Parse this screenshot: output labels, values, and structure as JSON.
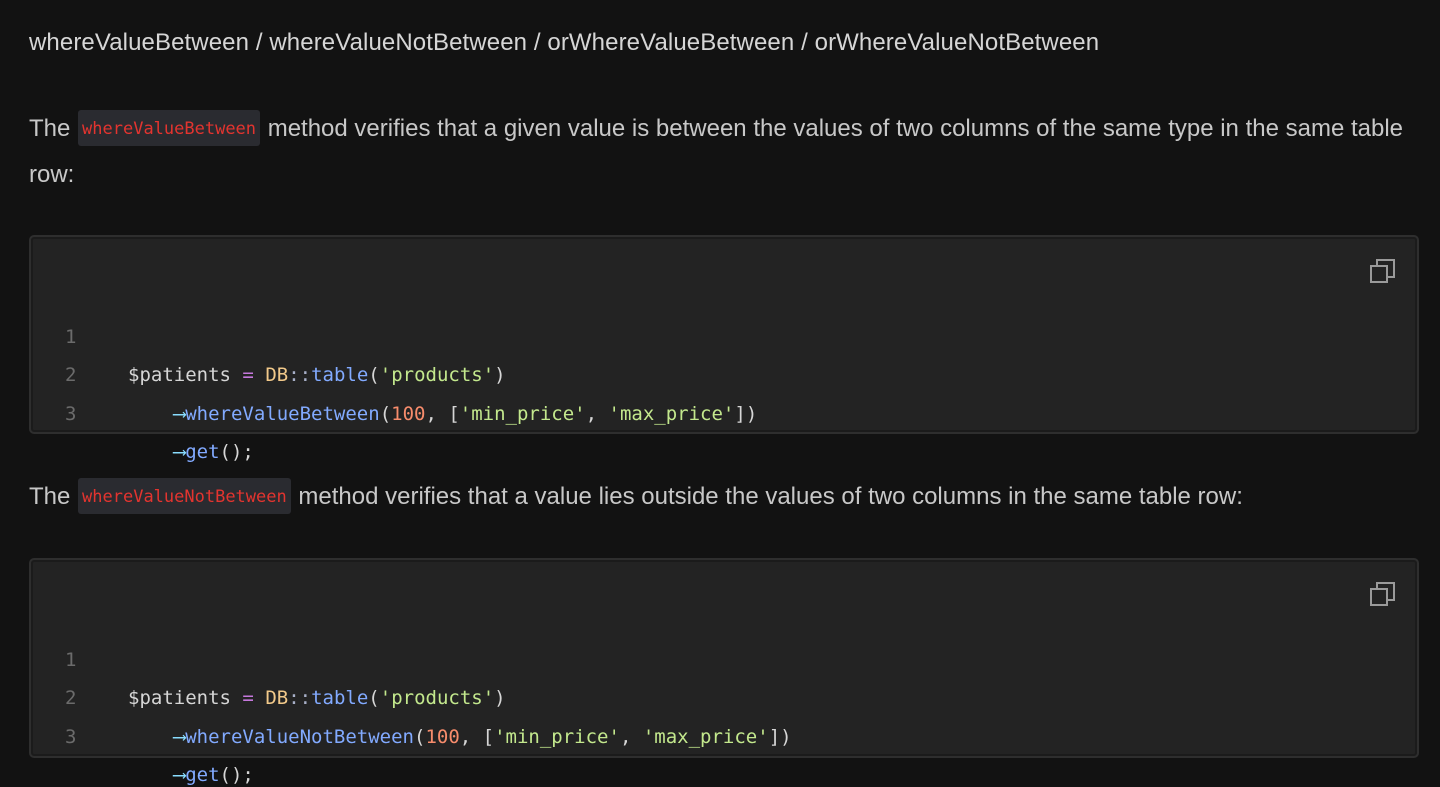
{
  "heading": "whereValueBetween / whereValueNotBetween / orWhereValueBetween / orWhereValueNotBetween",
  "para1": {
    "before": "The ",
    "code": "whereValueBetween",
    "after": " method verifies that a given value is between the values of two columns of the same type in the same table row:"
  },
  "para2": {
    "before": "The ",
    "code": "whereValueNotBetween",
    "after": " method verifies that a value lies outside the values of two columns in the same table row:"
  },
  "code1": {
    "copy_icon": "copy-icon",
    "lines": [
      {
        "num": "1",
        "indent": "",
        "t1": "$patients",
        "t2": " ",
        "t3": "=",
        "t4": " ",
        "t5": "DB",
        "t6": "::",
        "t7": "table",
        "t8": "(",
        "t9": "'products'",
        "t10": ")"
      },
      {
        "num": "2",
        "indent": "    ",
        "arrow": "⟶",
        "fn": "whereValueBetween",
        "open": "(",
        "num_arg": "100",
        "comma1": ", [",
        "s1": "'min_price'",
        "comma2": ", ",
        "s2": "'max_price'",
        "close": "])"
      },
      {
        "num": "3",
        "indent": "    ",
        "arrow": "⟶",
        "fn": "get",
        "rest": "();"
      }
    ]
  },
  "code2": {
    "copy_icon": "copy-icon",
    "lines": [
      {
        "num": "1",
        "indent": "",
        "t1": "$patients",
        "t2": " ",
        "t3": "=",
        "t4": " ",
        "t5": "DB",
        "t6": "::",
        "t7": "table",
        "t8": "(",
        "t9": "'products'",
        "t10": ")"
      },
      {
        "num": "2",
        "indent": "    ",
        "arrow": "⟶",
        "fn": "whereValueNotBetween",
        "open": "(",
        "num_arg": "100",
        "comma1": ", [",
        "s1": "'min_price'",
        "comma2": ", ",
        "s2": "'max_price'",
        "close": "])"
      },
      {
        "num": "3",
        "indent": "    ",
        "arrow": "⟶",
        "fn": "get",
        "rest": "();"
      }
    ]
  },
  "colors": {
    "background": "#121212",
    "code_background": "#232323",
    "inline_code_text": "#e3342f",
    "inline_code_bg": "#2a2b30"
  }
}
